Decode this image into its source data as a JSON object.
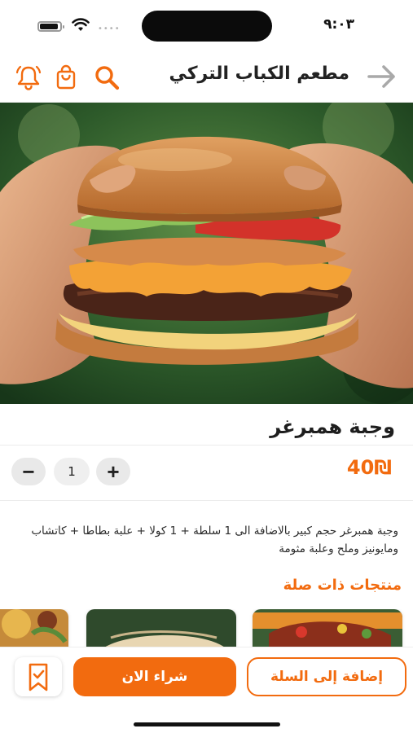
{
  "status_bar": {
    "time": "٩:٠٣"
  },
  "header": {
    "title": "مطعم الكباب التركي",
    "icons": [
      "back-arrow-icon",
      "search-icon",
      "shopping-bag-icon",
      "bell-icon"
    ]
  },
  "product": {
    "image": "burger-photo",
    "title": "وجبة همبرغر",
    "price": "40₪",
    "quantity": "1",
    "description": "وجبة همبرغر حجم كبير بالاضافة الى 1 سلطة + 1 كولا + علبة بطاطا + كاتشاب ومايونيز وملح وعلبة مثومة"
  },
  "related": {
    "title": "منتجات ذات صلة",
    "items": [
      "related-item-1",
      "related-item-2",
      "related-item-3"
    ]
  },
  "actions": {
    "add_to_cart": "إضافة إلى السلة",
    "buy_now": "شراء الان",
    "bookmark_icon": "bookmark-icon"
  },
  "colors": {
    "accent": "#f26b0f",
    "text": "#1e1e1e",
    "muted": "#e9e9e9"
  }
}
